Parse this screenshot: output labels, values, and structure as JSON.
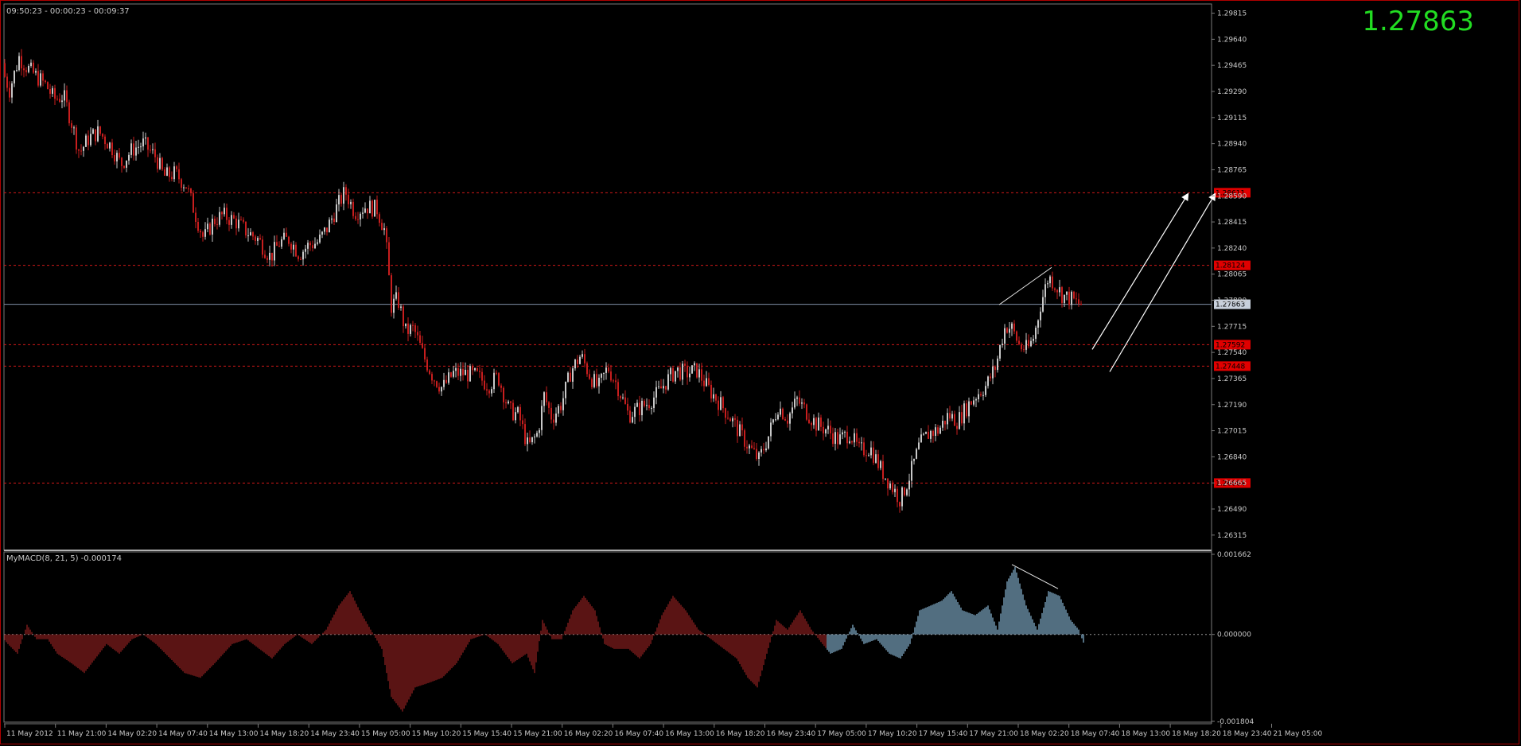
{
  "header": {
    "timer": "09:50:23 - 00:00:23 - 00:09:37",
    "last_price": "1.27863"
  },
  "colors": {
    "background": "#000000",
    "bull": "#c8c8c8",
    "bear": "#c81e1e",
    "level_line": "#d01818",
    "level_label_bg": "#e00000",
    "current_line": "#7f8fa6",
    "macd_neg": "#8b1f1f",
    "macd_pos": "#7fa9c6",
    "last_price": "#22dd22"
  },
  "chart_data": [
    {
      "type": "candlestick",
      "title": "",
      "x_labels": [
        "11 May 2012",
        "11 May 21:00",
        "14 May 02:20",
        "14 May 07:40",
        "14 May 13:00",
        "14 May 18:20",
        "14 May 23:40",
        "15 May 05:00",
        "15 May 10:20",
        "15 May 15:40",
        "15 May 21:00",
        "16 May 02:20",
        "16 May 07:40",
        "16 May 13:00",
        "16 May 18:20",
        "16 May 23:40",
        "17 May 05:00",
        "17 May 10:20",
        "17 May 15:40",
        "17 May 21:00",
        "18 May 02:20",
        "18 May 07:40",
        "18 May 13:00",
        "18 May 18:20",
        "18 May 23:40",
        "21 May 05:00"
      ],
      "y_ticks": [
        "1.29815",
        "1.29640",
        "1.29465",
        "1.29290",
        "1.29115",
        "1.28940",
        "1.28765",
        "1.28590",
        "1.28415",
        "1.28240",
        "1.28065",
        "1.27890",
        "1.27715",
        "1.27540",
        "1.27365",
        "1.27190",
        "1.27015",
        "1.26840",
        "1.26665",
        "1.26490",
        "1.26315"
      ],
      "ylim": [
        1.2625,
        1.2985
      ],
      "price_path": [
        [
          0,
          1.2948
        ],
        [
          12,
          1.293
        ],
        [
          24,
          1.2952
        ],
        [
          34,
          1.2945
        ],
        [
          48,
          1.2938
        ],
        [
          58,
          1.2933
        ],
        [
          68,
          1.2924
        ],
        [
          80,
          1.2926
        ],
        [
          90,
          1.2908
        ],
        [
          100,
          1.2888
        ],
        [
          112,
          1.2898
        ],
        [
          124,
          1.2902
        ],
        [
          140,
          1.2892
        ],
        [
          152,
          1.288
        ],
        [
          166,
          1.289
        ],
        [
          180,
          1.2894
        ],
        [
          196,
          1.2885
        ],
        [
          206,
          1.2872
        ],
        [
          220,
          1.2874
        ],
        [
          234,
          1.2866
        ],
        [
          246,
          1.2846
        ],
        [
          256,
          1.283
        ],
        [
          268,
          1.2842
        ],
        [
          280,
          1.2846
        ],
        [
          296,
          1.2842
        ],
        [
          310,
          1.2835
        ],
        [
          324,
          1.283
        ],
        [
          340,
          1.2818
        ],
        [
          352,
          1.2828
        ],
        [
          364,
          1.283
        ],
        [
          376,
          1.282
        ],
        [
          388,
          1.2826
        ],
        [
          400,
          1.2828
        ],
        [
          412,
          1.2838
        ],
        [
          424,
          1.2852
        ],
        [
          434,
          1.2862
        ],
        [
          446,
          1.2848
        ],
        [
          460,
          1.2852
        ],
        [
          474,
          1.285
        ],
        [
          484,
          1.2835
        ],
        [
          492,
          1.2785
        ],
        [
          500,
          1.279
        ],
        [
          510,
          1.2768
        ],
        [
          520,
          1.277
        ],
        [
          532,
          1.2752
        ],
        [
          544,
          1.2738
        ],
        [
          556,
          1.273
        ],
        [
          570,
          1.274
        ],
        [
          584,
          1.274
        ],
        [
          600,
          1.2738
        ],
        [
          614,
          1.2732
        ],
        [
          626,
          1.2738
        ],
        [
          640,
          1.2715
        ],
        [
          652,
          1.2712
        ],
        [
          664,
          1.269
        ],
        [
          676,
          1.27
        ],
        [
          684,
          1.2725
        ],
        [
          694,
          1.271
        ],
        [
          706,
          1.272
        ],
        [
          718,
          1.2742
        ],
        [
          730,
          1.2752
        ],
        [
          742,
          1.2738
        ],
        [
          752,
          1.273
        ],
        [
          764,
          1.2744
        ],
        [
          776,
          1.2732
        ],
        [
          790,
          1.2712
        ],
        [
          802,
          1.2716
        ],
        [
          814,
          1.272
        ],
        [
          826,
          1.2726
        ],
        [
          838,
          1.2735
        ],
        [
          850,
          1.2742
        ],
        [
          862,
          1.274
        ],
        [
          876,
          1.2742
        ],
        [
          890,
          1.273
        ],
        [
          902,
          1.2722
        ],
        [
          916,
          1.2712
        ],
        [
          930,
          1.27
        ],
        [
          942,
          1.269
        ],
        [
          954,
          1.2682
        ],
        [
          966,
          1.2698
        ],
        [
          978,
          1.2718
        ],
        [
          990,
          1.271
        ],
        [
          1002,
          1.2722
        ],
        [
          1014,
          1.2714
        ],
        [
          1026,
          1.2706
        ],
        [
          1040,
          1.2702
        ],
        [
          1054,
          1.2695
        ],
        [
          1068,
          1.27
        ],
        [
          1080,
          1.2688
        ],
        [
          1094,
          1.269
        ],
        [
          1108,
          1.2675
        ],
        [
          1120,
          1.2665
        ],
        [
          1132,
          1.2655
        ],
        [
          1144,
          1.2672
        ],
        [
          1156,
          1.2692
        ],
        [
          1168,
          1.27
        ],
        [
          1180,
          1.2702
        ],
        [
          1192,
          1.2712
        ],
        [
          1204,
          1.2708
        ],
        [
          1216,
          1.2718
        ],
        [
          1228,
          1.2726
        ],
        [
          1240,
          1.2732
        ],
        [
          1252,
          1.2745
        ],
        [
          1258,
          1.276
        ],
        [
          1264,
          1.2772
        ],
        [
          1272,
          1.277
        ],
        [
          1282,
          1.2758
        ],
        [
          1292,
          1.2756
        ],
        [
          1300,
          1.2765
        ],
        [
          1308,
          1.2786
        ],
        [
          1318,
          1.2805
        ],
        [
          1326,
          1.28
        ],
        [
          1336,
          1.2792
        ],
        [
          1346,
          1.279
        ],
        [
          1354,
          1.2787
        ],
        [
          1360,
          1.27863
        ]
      ],
      "levels": [
        {
          "price": "1.28611",
          "value": 1.28611
        },
        {
          "price": "1.28124",
          "value": 1.28124
        },
        {
          "price": "1.27592",
          "value": 1.27592
        },
        {
          "price": "1.27448",
          "value": 1.27448
        },
        {
          "price": "1.26664",
          "value": 1.26664
        }
      ],
      "current": {
        "price": "1.27863",
        "value": 1.27863
      },
      "trendlines": [
        {
          "x": [
            1256,
            1322
          ],
          "y": [
            1.2786,
            1.2811
          ]
        }
      ],
      "arrows": [
        {
          "x": [
            1373,
            1493
          ],
          "y": [
            1.2756,
            1.286
          ]
        },
        {
          "x": [
            1395,
            1527
          ],
          "y": [
            1.2741,
            1.286
          ]
        }
      ]
    },
    {
      "type": "histogram",
      "title": "MyMACD(8, 21, 5) -0.000174",
      "y_ticks": [
        "0.001662",
        "0.000000",
        "-0.001804"
      ],
      "ylim": [
        -0.001804,
        0.001662
      ],
      "macd_path": [
        [
          0,
          0.0
        ],
        [
          10,
          -0.0002
        ],
        [
          22,
          -0.0004
        ],
        [
          34,
          0.0002
        ],
        [
          46,
          -0.0001
        ],
        [
          60,
          -0.0001
        ],
        [
          72,
          -0.0004
        ],
        [
          90,
          -0.0006
        ],
        [
          106,
          -0.0008
        ],
        [
          120,
          -0.0005
        ],
        [
          134,
          -0.0002
        ],
        [
          150,
          -0.0004
        ],
        [
          166,
          -0.0001
        ],
        [
          180,
          0.0
        ],
        [
          196,
          -0.0002
        ],
        [
          214,
          -0.0005
        ],
        [
          232,
          -0.0008
        ],
        [
          252,
          -0.0009
        ],
        [
          270,
          -0.0006
        ],
        [
          292,
          -0.0002
        ],
        [
          310,
          -0.0001
        ],
        [
          326,
          -0.0003
        ],
        [
          342,
          -0.0005
        ],
        [
          358,
          -0.0002
        ],
        [
          374,
          0.0
        ],
        [
          392,
          -0.0002
        ],
        [
          410,
          0.0001
        ],
        [
          426,
          0.0006
        ],
        [
          440,
          0.0009
        ],
        [
          452,
          0.0005
        ],
        [
          466,
          0.0001
        ],
        [
          480,
          -0.0003
        ],
        [
          492,
          -0.0013
        ],
        [
          506,
          -0.0016
        ],
        [
          522,
          -0.0011
        ],
        [
          540,
          -0.001
        ],
        [
          556,
          -0.0009
        ],
        [
          574,
          -0.0006
        ],
        [
          592,
          -0.0001
        ],
        [
          610,
          0.0
        ],
        [
          626,
          -0.0002
        ],
        [
          644,
          -0.0006
        ],
        [
          662,
          -0.0004
        ],
        [
          672,
          -0.0008
        ],
        [
          682,
          0.0003
        ],
        [
          694,
          -0.0001
        ],
        [
          706,
          -0.0001
        ],
        [
          720,
          0.0005
        ],
        [
          734,
          0.0008
        ],
        [
          748,
          0.0005
        ],
        [
          760,
          -0.0002
        ],
        [
          772,
          -0.0003
        ],
        [
          790,
          -0.0003
        ],
        [
          804,
          -0.0005
        ],
        [
          818,
          -0.0002
        ],
        [
          832,
          0.0004
        ],
        [
          846,
          0.0008
        ],
        [
          862,
          0.0005
        ],
        [
          878,
          0.0001
        ],
        [
          894,
          -0.0001
        ],
        [
          910,
          -0.0003
        ],
        [
          926,
          -0.0005
        ],
        [
          940,
          -0.0009
        ],
        [
          952,
          -0.0011
        ],
        [
          964,
          -0.0004
        ],
        [
          976,
          0.0003
        ],
        [
          990,
          0.0001
        ],
        [
          1006,
          0.0005
        ],
        [
          1020,
          0.0001
        ],
        [
          1034,
          -0.0002
        ],
        [
          1044,
          -0.0004
        ],
        [
          1058,
          -0.0003
        ],
        [
          1072,
          0.0002
        ],
        [
          1086,
          -0.0002
        ],
        [
          1102,
          -0.0001
        ],
        [
          1118,
          -0.0004
        ],
        [
          1132,
          -0.0005
        ],
        [
          1144,
          -0.0002
        ],
        [
          1156,
          0.0005
        ],
        [
          1170,
          0.0006
        ],
        [
          1184,
          0.0007
        ],
        [
          1196,
          0.0009
        ],
        [
          1210,
          0.0005
        ],
        [
          1226,
          0.0004
        ],
        [
          1242,
          0.0006
        ],
        [
          1254,
          0.0001
        ],
        [
          1266,
          0.0011
        ],
        [
          1276,
          0.0014
        ],
        [
          1290,
          0.0006
        ],
        [
          1304,
          0.0001
        ],
        [
          1318,
          0.0009
        ],
        [
          1332,
          0.0008
        ],
        [
          1346,
          0.0003
        ],
        [
          1356,
          0.0001
        ],
        [
          1362,
          -0.00017
        ]
      ],
      "positive_from_x": 1040,
      "divergence": {
        "x": [
          1272,
          1330
        ],
        "y": [
          0.00145,
          0.00095
        ]
      }
    }
  ]
}
